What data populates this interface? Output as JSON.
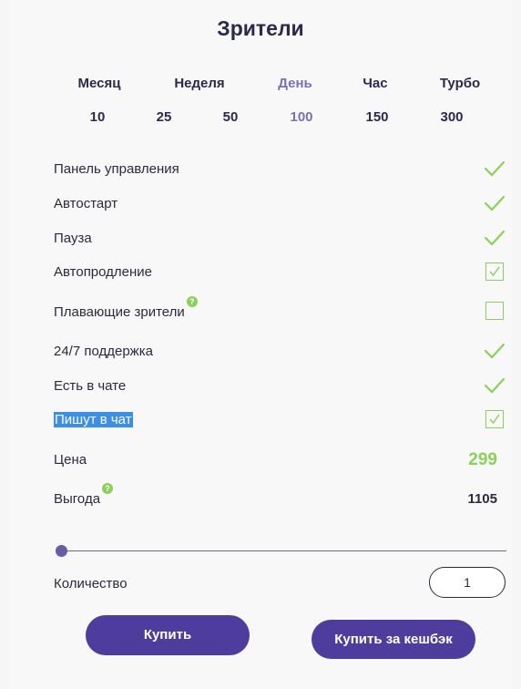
{
  "header": {
    "title": "Зрители"
  },
  "periods": [
    {
      "label": "Месяц"
    },
    {
      "label": "Неделя"
    },
    {
      "label": "День",
      "selected": true
    },
    {
      "label": "Час"
    },
    {
      "label": "Турбо"
    }
  ],
  "counts": [
    {
      "label": "10"
    },
    {
      "label": "25"
    },
    {
      "label": "50"
    },
    {
      "label": "100",
      "selected": true
    },
    {
      "label": "150"
    },
    {
      "label": "300"
    }
  ],
  "features": [
    {
      "label": "Панель управления",
      "state": "check"
    },
    {
      "label": "Автостарт",
      "state": "check"
    },
    {
      "label": "Пауза",
      "state": "check"
    },
    {
      "label": "Автопродление",
      "state": "checkbox-checked"
    },
    {
      "label": "Плавающие зрители",
      "state": "checkbox-empty",
      "help": true
    },
    {
      "label": "24/7 поддержка",
      "state": "check"
    },
    {
      "label": "Есть в чате",
      "state": "check"
    },
    {
      "label": "Пишут в чат",
      "state": "checkbox-checked",
      "highlighted": true
    }
  ],
  "help_icon_text": "?",
  "price": {
    "label": "Цена",
    "value": "299"
  },
  "benefit": {
    "label": "Выгода",
    "value": "1105"
  },
  "slider": {
    "value_fraction": 0
  },
  "quantity": {
    "label": "Количество",
    "value": "1"
  },
  "buttons": {
    "buy": "Купить",
    "buy_cashback": "Купить за кешбэк"
  },
  "colors": {
    "accent": "#4e3d9c",
    "selected": "#7b6fb3",
    "check": "#8bd05a",
    "price": "#8bd05a",
    "highlight": "#3d8ee8"
  }
}
